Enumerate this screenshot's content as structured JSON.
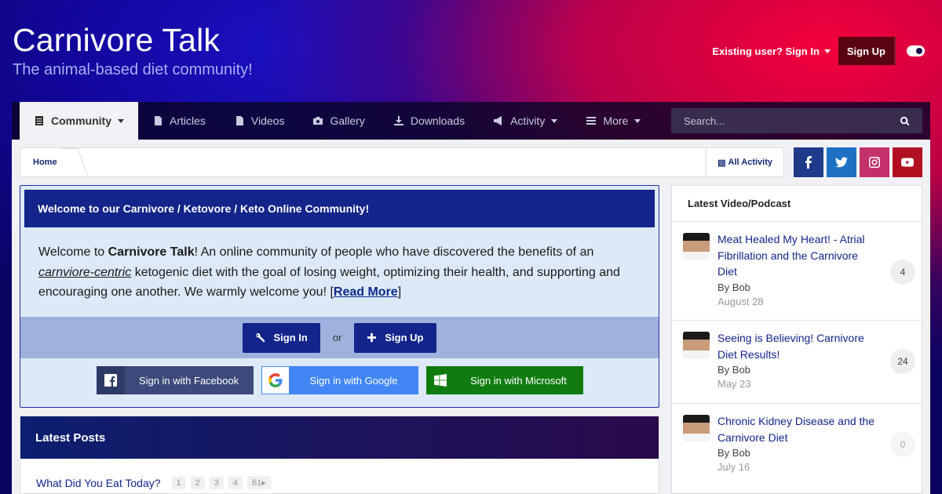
{
  "header": {
    "site_title": "Carnivore Talk",
    "tagline": "The animal-based diet community!",
    "signin_label": "Existing user? Sign In",
    "signup_label": "Sign Up"
  },
  "nav": {
    "tabs": [
      {
        "label": "Community",
        "icon": "list-icon",
        "active": true,
        "dropdown": true
      },
      {
        "label": "Articles",
        "icon": "article-icon"
      },
      {
        "label": "Videos",
        "icon": "video-file-icon"
      },
      {
        "label": "Gallery",
        "icon": "camera-icon"
      },
      {
        "label": "Downloads",
        "icon": "download-icon"
      },
      {
        "label": "Activity",
        "icon": "megaphone-icon",
        "dropdown": true
      },
      {
        "label": "More",
        "icon": "menu-icon",
        "dropdown": true
      }
    ],
    "search_placeholder": "Search..."
  },
  "breadcrumb": {
    "home": "Home",
    "all_activity": "All Activity"
  },
  "social": {
    "colors": {
      "facebook": "#1f3a8a",
      "twitter": "#1d70c4",
      "instagram": "#c4306a",
      "youtube": "#b01020"
    }
  },
  "welcome": {
    "title": "Welcome to our Carnivore / Ketovore / Keto Online Community!",
    "text_1": "Welcome to ",
    "brand": "Carnivore Talk",
    "text_2": "! An online community of people who have discovered the benefits of an ",
    "emphasis": "carnviore-centric",
    "text_3": " ketogenic diet with the goal of losing weight, optimizing their health, and supporting and encouraging one another. We warmly welcome you! [",
    "read_more": "Read More",
    "text_4": "]",
    "signin_button": "Sign In",
    "or": "or",
    "signup_button": "Sign Up",
    "providers": [
      {
        "label": "Sign in with Facebook",
        "color": "#3b4a7a"
      },
      {
        "label": "Sign in with Google",
        "color": "#4285f4"
      },
      {
        "label": "Sign in with Microsoft",
        "color": "#107c10"
      }
    ]
  },
  "latest_posts": {
    "title": "Latest Posts",
    "topics": [
      {
        "title": "What Did You Eat Today?",
        "pages": [
          "1",
          "2",
          "3",
          "4",
          "61"
        ]
      }
    ]
  },
  "sidebar": {
    "title": "Latest Video/Podcast",
    "items": [
      {
        "title": "Meat Healed My Heart! - Atrial Fibrillation and the Carnivore Diet",
        "by": "By Bob",
        "date": "August 28",
        "count": "4"
      },
      {
        "title": "Seeing is Believing! Carnivore Diet Results!",
        "by": "By Bob",
        "date": "May 23",
        "count": "24"
      },
      {
        "title": "Chronic Kidney Disease and the Carnivore Diet",
        "by": "By Bob",
        "date": "July 16",
        "count": "0"
      }
    ]
  }
}
